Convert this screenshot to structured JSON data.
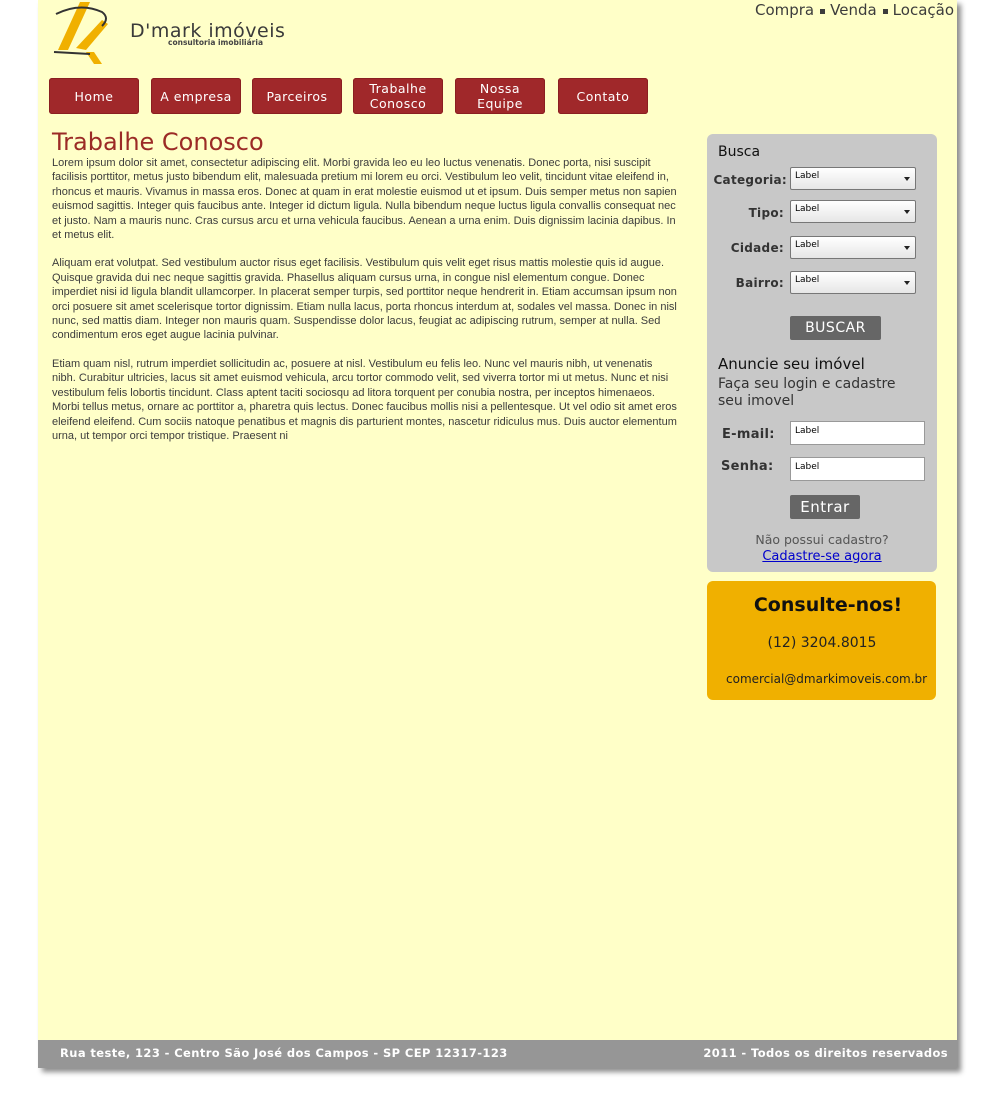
{
  "brand": {
    "name": "D'mark imóveis",
    "tagline": "consultoria imobiliária",
    "logo_color": "#f0b000"
  },
  "top_links": [
    "Compra",
    "Venda",
    "Locação"
  ],
  "nav": [
    {
      "label": "Home"
    },
    {
      "label": "A empresa"
    },
    {
      "label": "Parceiros"
    },
    {
      "label": "Trabalhe\nConosco"
    },
    {
      "label": "Nossa\nEquipe"
    },
    {
      "label": "Contato"
    }
  ],
  "page_title": "Trabalhe Conosco",
  "content": {
    "paragraphs": [
      "Lorem ipsum dolor sit amet, consectetur adipiscing elit. Morbi gravida leo eu leo luctus venenatis. Donec porta, nisi suscipit facilisis porttitor, metus justo bibendum elit, malesuada pretium mi lorem eu orci. Vestibulum leo velit, tincidunt vitae eleifend in, rhoncus et mauris. Vivamus in massa eros. Donec at quam in erat molestie euismod ut et ipsum. Duis semper metus non sapien euismod sagittis. Integer quis faucibus ante. Integer id dictum ligula. Nulla bibendum neque luctus ligula convallis consequat nec et justo. Nam a mauris nunc. Cras cursus arcu et urna vehicula faucibus. Aenean a urna enim. Duis dignissim lacinia dapibus. In et metus elit.",
      "Aliquam erat volutpat. Sed vestibulum auctor risus eget facilisis. Vestibulum quis velit eget risus mattis molestie quis id augue. Quisque gravida dui nec neque sagittis gravida. Phasellus aliquam cursus urna, in congue nisl elementum congue. Donec imperdiet nisi id ligula blandit ullamcorper. In placerat semper turpis, sed porttitor neque hendrerit in. Etiam accumsan ipsum non orci posuere sit amet scelerisque tortor dignissim. Etiam nulla lacus, porta rhoncus interdum at, sodales vel massa. Donec in nisl nunc, sed mattis diam. Integer non mauris quam. Suspendisse dolor lacus, feugiat ac adipiscing rutrum, semper at nulla. Sed condimentum eros eget augue lacinia pulvinar.",
      "Etiam quam nisl, rutrum imperdiet sollicitudin ac, posuere at nisl. Vestibulum eu felis leo. Nunc vel mauris nibh, ut venenatis nibh. Curabitur ultricies, lacus sit amet euismod vehicula, arcu tortor commodo velit, sed viverra tortor mi ut metus. Nunc et nisi vestibulum felis lobortis tincidunt. Class aptent taciti sociosqu ad litora torquent per conubia nostra, per inceptos himenaeos. Morbi tellus metus, ornare ac porttitor a, pharetra quis lectus. Donec faucibus mollis nisi a pellentesque. Ut vel odio sit amet eros eleifend eleifend. Cum sociis natoque penatibus et magnis dis parturient montes, nascetur ridiculus mus. Duis auctor elementum urna, ut tempor orci tempor tristique. Praesent ni"
    ]
  },
  "search": {
    "heading": "Busca",
    "fields": [
      {
        "label": "Categoria:",
        "value": "Label"
      },
      {
        "label": "Tipo:",
        "value": "Label"
      },
      {
        "label": "Cidade:",
        "value": "Label"
      },
      {
        "label": "Bairro:",
        "value": "Label"
      }
    ],
    "button": "BUSCAR"
  },
  "announce": {
    "heading": "Anuncie seu imóvel",
    "text": "Faça seu login e cadastre seu imovel",
    "email_label": "E-mail:",
    "email_value": "Label",
    "password_label": "Senha:",
    "password_value": "Label",
    "login_button": "Entrar",
    "no_account": "Não possui cadastro?",
    "register_link": "Cadastre-se agora"
  },
  "contact_box": {
    "title": "Consulte-nos!",
    "phone": "(12) 3204.8015",
    "email": "comercial@dmarkimoveis.com.br"
  },
  "footer": {
    "address": "Rua teste, 123 - Centro São José dos Campos - SP CEP 12317-123",
    "copyright": "2011 - Todos os direitos reservados"
  },
  "colors": {
    "page_bg": "#ffffc8",
    "nav_bg": "#a0282a",
    "title": "#9b2b26",
    "sidebar_bg": "#c8c8c8",
    "contact_bg": "#f0b000",
    "footer_bg": "#969696"
  }
}
